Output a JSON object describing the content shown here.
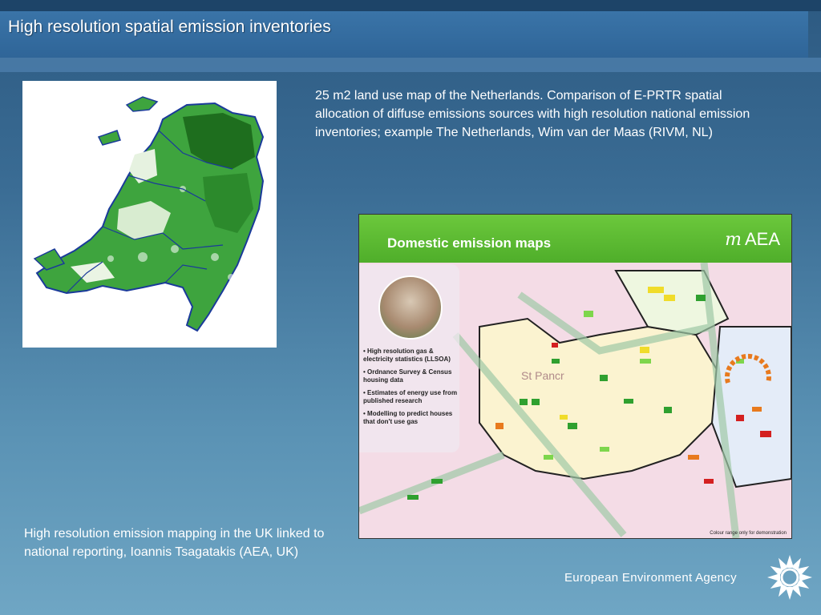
{
  "slide": {
    "title": "High resolution spatial emission inventories",
    "caption_top": "25 m2 land use map of the Netherlands. Comparison of E-PRTR spatial allocation of diffuse emissions sources with high resolution national emission inventories; example The Netherlands, Wim van der Maas (RIVM, NL)",
    "caption_bottom": "High resolution emission mapping in the UK linked to national reporting, Ioannis Tsagatakis (AEA, UK)"
  },
  "uk_map": {
    "header_title": "Domestic emission maps",
    "logo_text": "AEA",
    "bullets": [
      "• High resolution gas & electricity statistics (LLSOA)",
      "• Ordnance Survey & Census housing data",
      "• Estimates of energy use from published research",
      "• Modelling to predict houses that don't use gas"
    ],
    "footnote": "Colour range only for demonstration",
    "place_label": "St Pancr"
  },
  "footer": {
    "agency_name": "European Environment Agency"
  },
  "colors": {
    "title_bar": "#2f6598",
    "aea_green": "#4fae2a",
    "map_green": "#1f8a1f"
  }
}
